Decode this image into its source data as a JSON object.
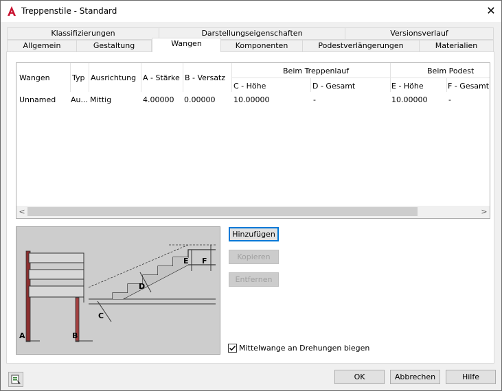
{
  "window": {
    "title": "Treppenstile - Standard",
    "close_glyph": "✕"
  },
  "tabs_back": [
    "Klassifizierungen",
    "Darstellungseigenschaften",
    "Versionsverlauf"
  ],
  "tabs_front": [
    "Allgemein",
    "Gestaltung",
    "Wangen",
    "Komponenten",
    "Podestverlängerungen",
    "Materialien"
  ],
  "active_tab": "Wangen",
  "table": {
    "headers": {
      "wangen": "Wangen",
      "typ": "Typ",
      "ausrichtung": "Ausrichtung",
      "a": "A - Stärke",
      "b": "B - Versatz",
      "group_run": "Beim Treppenlauf",
      "c": "C - Höhe",
      "d": "D - Gesamt",
      "group_landing": "Beim Podest",
      "e": "E - Höhe",
      "f": "F - Gesamt"
    },
    "rows": [
      {
        "wangen": "Unnamed",
        "typ": "Au...",
        "ausrichtung": "Mittig",
        "a": "4.00000",
        "b": "0.00000",
        "c": "10.00000",
        "d": "-",
        "e": "10.00000",
        "f": "-"
      }
    ],
    "scroll_left": "<",
    "scroll_right": ">"
  },
  "diagram": {
    "labels": [
      "A",
      "B",
      "C",
      "D",
      "E",
      "F"
    ]
  },
  "buttons": {
    "add": "Hinzufügen",
    "copy": "Kopieren",
    "remove": "Entfernen",
    "ok": "OK",
    "cancel": "Abbrechen",
    "help": "Hilfe"
  },
  "checkbox": {
    "label": "Mittelwange an Drehungen biegen",
    "checked": true,
    "check_glyph": "✓"
  },
  "icons": {
    "app": "autocad-logo-icon",
    "close": "close-icon",
    "bottom_left": "settings-icon"
  }
}
